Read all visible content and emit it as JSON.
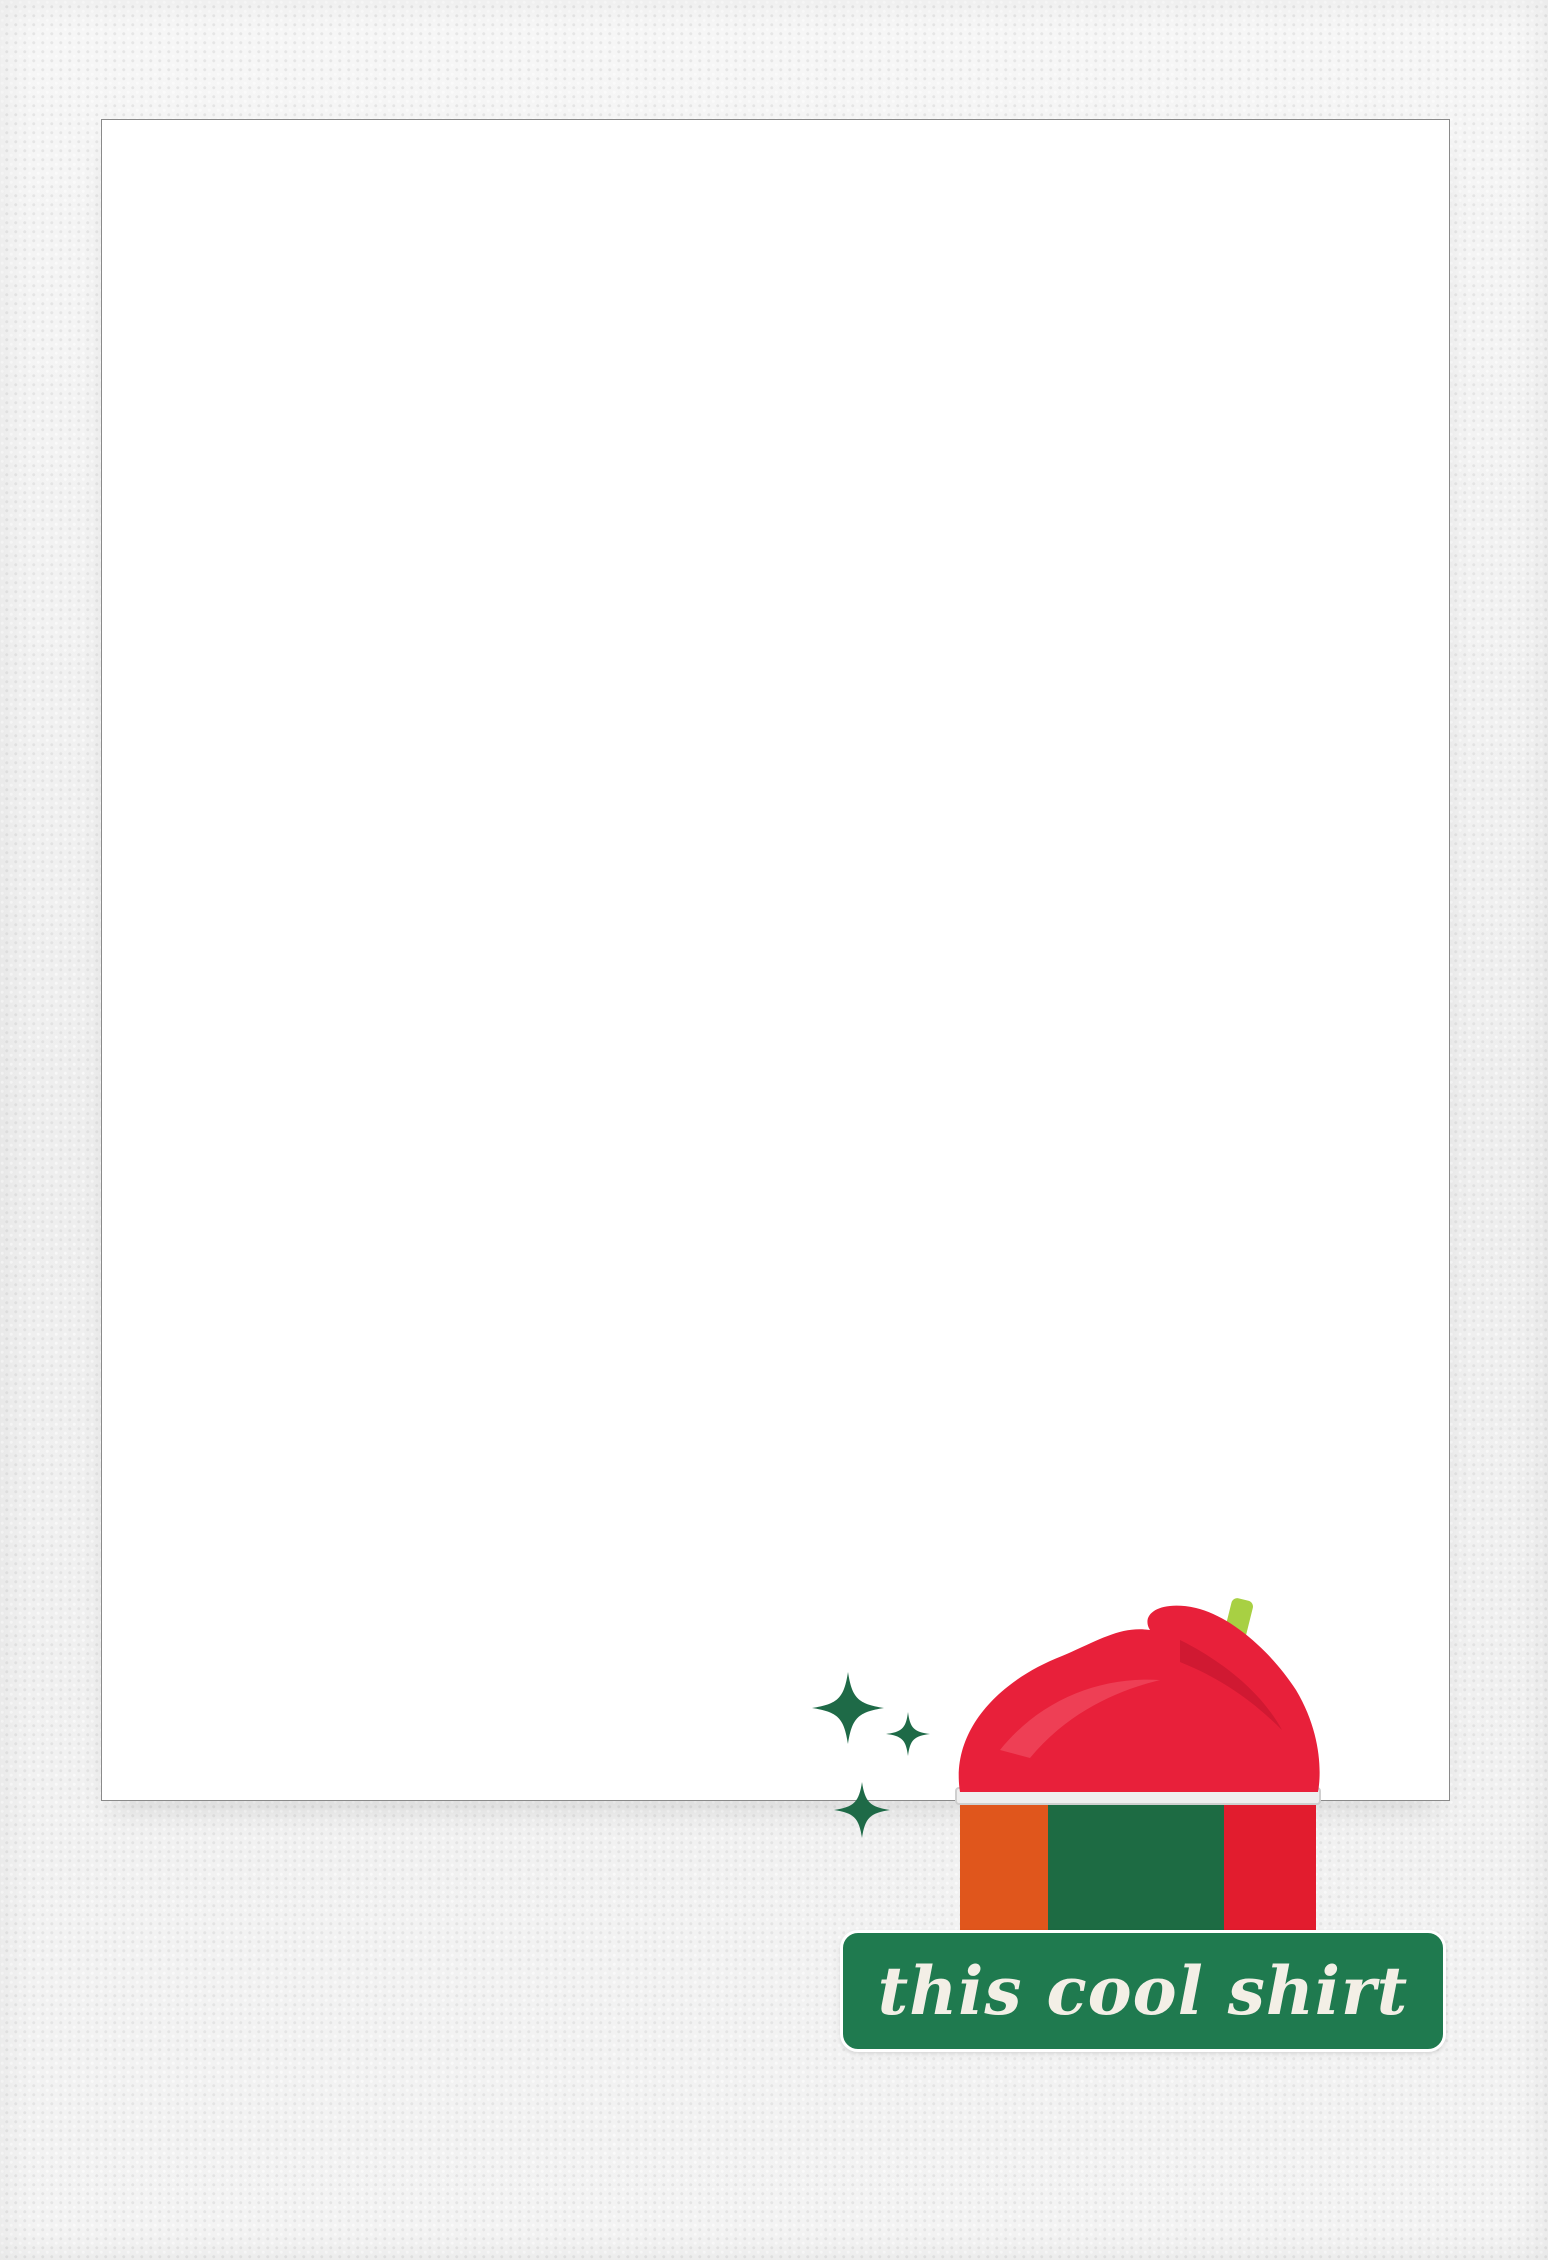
{
  "sticker": {
    "caption": "this cool shirt",
    "icon": "slushie-cup-icon",
    "decoration": "sparkle-icon"
  },
  "colors": {
    "label_green": "#1f7a4f",
    "slushie_red": "#e8203a",
    "cup_orange": "#e0561c",
    "cup_green": "#1d6b43",
    "cup_red": "#e21c2e",
    "straw_green": "#a8d043",
    "sparkle_green": "#1e6a47"
  }
}
